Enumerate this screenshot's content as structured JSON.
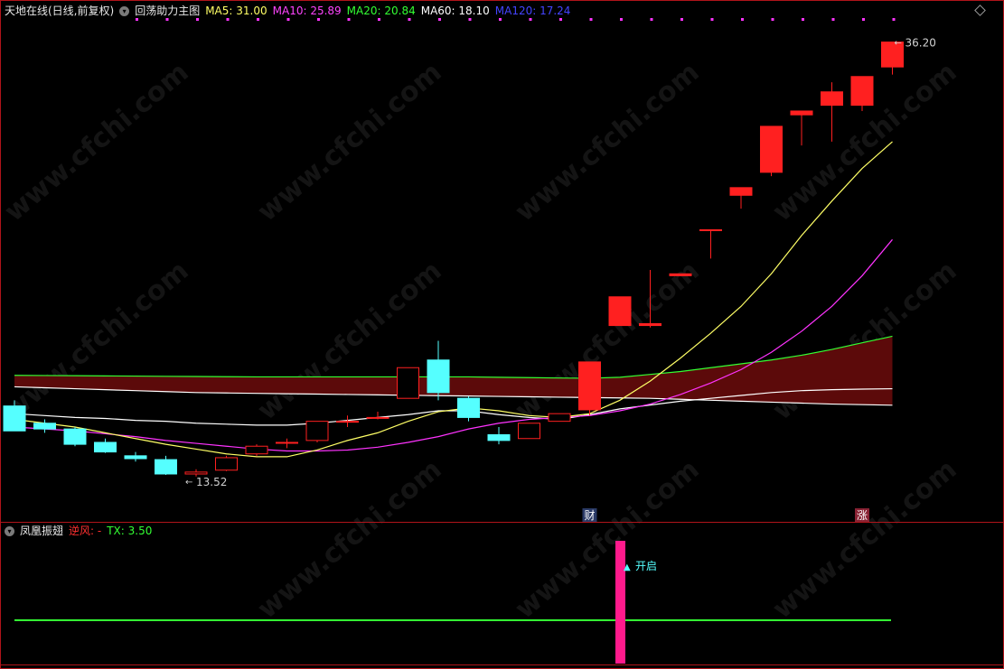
{
  "main_panel": {
    "title": "天地在线(日线,前复权)",
    "indicator": "回荡助力主图",
    "ma_labels": [
      {
        "text": "MA5: 31.00",
        "color": "#ffff66"
      },
      {
        "text": "MA10: 25.89",
        "color": "#ff44ff"
      },
      {
        "text": "MA20: 20.84",
        "color": "#33ff33"
      },
      {
        "text": "MA60: 18.10",
        "color": "#ffffff"
      },
      {
        "text": "MA120: 17.24",
        "color": "#4444ff"
      }
    ],
    "markers": {
      "cai": "财",
      "zhang": "涨"
    },
    "high_label": "36.20",
    "low_label": "13.52"
  },
  "sub_panel": {
    "title": "凤凰振翅",
    "ni_feng": "逆风: -",
    "tx": "TX: 3.50",
    "signal_label": "开启"
  },
  "watermark": "www.cfchi.com",
  "colors": {
    "up": "#ff2020",
    "down": "#55ffff",
    "grid": "#b0141a",
    "signal": "#ff1a8c",
    "tx_line": "#33ff33"
  },
  "chart_data": {
    "type": "candlestick",
    "ylim": [
      12,
      37.5
    ],
    "candles": [
      {
        "o": 17.2,
        "h": 17.5,
        "l": 15.9,
        "c": 15.9
      },
      {
        "o": 16.3,
        "h": 16.5,
        "l": 15.8,
        "c": 16.0
      },
      {
        "o": 16.0,
        "h": 16.1,
        "l": 15.1,
        "c": 15.2
      },
      {
        "o": 15.3,
        "h": 15.5,
        "l": 14.75,
        "c": 14.8
      },
      {
        "o": 14.6,
        "h": 14.8,
        "l": 14.3,
        "c": 14.45
      },
      {
        "o": 14.4,
        "h": 14.6,
        "l": 13.6,
        "c": 13.65
      },
      {
        "o": 13.65,
        "h": 13.9,
        "l": 13.52,
        "c": 13.75
      },
      {
        "o": 13.85,
        "h": 14.6,
        "l": 13.8,
        "c": 14.5
      },
      {
        "o": 14.7,
        "h": 15.2,
        "l": 14.6,
        "c": 15.1
      },
      {
        "o": 15.3,
        "h": 15.5,
        "l": 15.0,
        "c": 15.3
      },
      {
        "o": 15.4,
        "h": 16.4,
        "l": 15.3,
        "c": 16.4
      },
      {
        "o": 16.4,
        "h": 16.7,
        "l": 16.1,
        "c": 16.4
      },
      {
        "o": 16.6,
        "h": 16.9,
        "l": 16.5,
        "c": 16.6
      },
      {
        "o": 17.6,
        "h": 17.6,
        "l": 17.6,
        "c": 19.2
      },
      {
        "o": 19.6,
        "h": 20.6,
        "l": 17.5,
        "c": 17.9
      },
      {
        "o": 17.6,
        "h": 17.7,
        "l": 16.4,
        "c": 16.6
      },
      {
        "o": 15.7,
        "h": 16.1,
        "l": 15.2,
        "c": 15.4
      },
      {
        "o": 15.5,
        "h": 16.3,
        "l": 15.5,
        "c": 16.3
      },
      {
        "o": 16.4,
        "h": 16.8,
        "l": 16.4,
        "c": 16.8
      },
      {
        "o": 17.0,
        "h": 19.2,
        "l": 16.7,
        "c": 19.5
      },
      {
        "o": 21.4,
        "h": 21.4,
        "l": 21.4,
        "c": 22.9
      },
      {
        "o": 21.4,
        "h": 24.3,
        "l": 21.3,
        "c": 21.5
      },
      {
        "o": 24.0,
        "h": 24.1,
        "l": 24.0,
        "c": 24.1
      },
      {
        "o": 26.4,
        "h": 26.4,
        "l": 24.9,
        "c": 26.4
      },
      {
        "o": 28.2,
        "h": 28.4,
        "l": 27.5,
        "c": 28.6
      },
      {
        "o": 29.4,
        "h": 31.8,
        "l": 29.2,
        "c": 31.8
      },
      {
        "o": 32.4,
        "h": 32.6,
        "l": 30.8,
        "c": 32.6
      },
      {
        "o": 32.9,
        "h": 34.1,
        "l": 31.0,
        "c": 33.6
      },
      {
        "o": 32.9,
        "h": 34.4,
        "l": 32.6,
        "c": 34.4
      },
      {
        "o": 34.9,
        "h": 36.2,
        "l": 34.5,
        "c": 36.2
      }
    ],
    "ma_lines": {
      "MA5": [
        16.5,
        16.3,
        16.1,
        15.8,
        15.5,
        15.2,
        14.95,
        14.7,
        14.55,
        14.55,
        14.9,
        15.4,
        15.8,
        16.4,
        16.9,
        17.1,
        16.95,
        16.7,
        16.6,
        16.8,
        17.5,
        18.5,
        19.7,
        21.0,
        22.4,
        24.1,
        26.1,
        27.9,
        29.6,
        31.0
      ],
      "MA10": [
        16.1,
        16.0,
        15.9,
        15.75,
        15.6,
        15.4,
        15.25,
        15.1,
        14.95,
        14.85,
        14.85,
        14.9,
        15.05,
        15.3,
        15.6,
        16.0,
        16.3,
        16.5,
        16.6,
        16.7,
        16.95,
        17.3,
        17.8,
        18.4,
        19.1,
        20.0,
        21.1,
        22.4,
        24.0,
        25.89
      ],
      "MA60": [
        16.8,
        16.7,
        16.6,
        16.55,
        16.45,
        16.4,
        16.3,
        16.25,
        16.2,
        16.2,
        16.3,
        16.45,
        16.6,
        16.75,
        16.95,
        16.95,
        16.75,
        16.6,
        16.5,
        16.75,
        17.05,
        17.25,
        17.45,
        17.6,
        17.75,
        17.9,
        18.0,
        18.05,
        18.08,
        18.1
      ],
      "MA120": [
        18.2,
        18.15,
        18.1,
        18.05,
        18.0,
        17.95,
        17.9,
        17.88,
        17.86,
        17.84,
        17.82,
        17.8,
        17.78,
        17.76,
        17.74,
        17.72,
        17.7,
        17.68,
        17.66,
        17.64,
        17.62,
        17.6,
        17.55,
        17.5,
        17.45,
        17.4,
        17.35,
        17.3,
        17.27,
        17.24
      ],
      "MA20": [
        18.8,
        18.79,
        18.78,
        18.77,
        18.76,
        18.75,
        18.74,
        18.73,
        18.72,
        18.72,
        18.72,
        18.72,
        18.72,
        18.72,
        18.72,
        18.72,
        18.7,
        18.68,
        18.66,
        18.65,
        18.7,
        18.85,
        19.0,
        19.2,
        19.4,
        19.6,
        19.85,
        20.15,
        20.5,
        20.84
      ]
    }
  }
}
